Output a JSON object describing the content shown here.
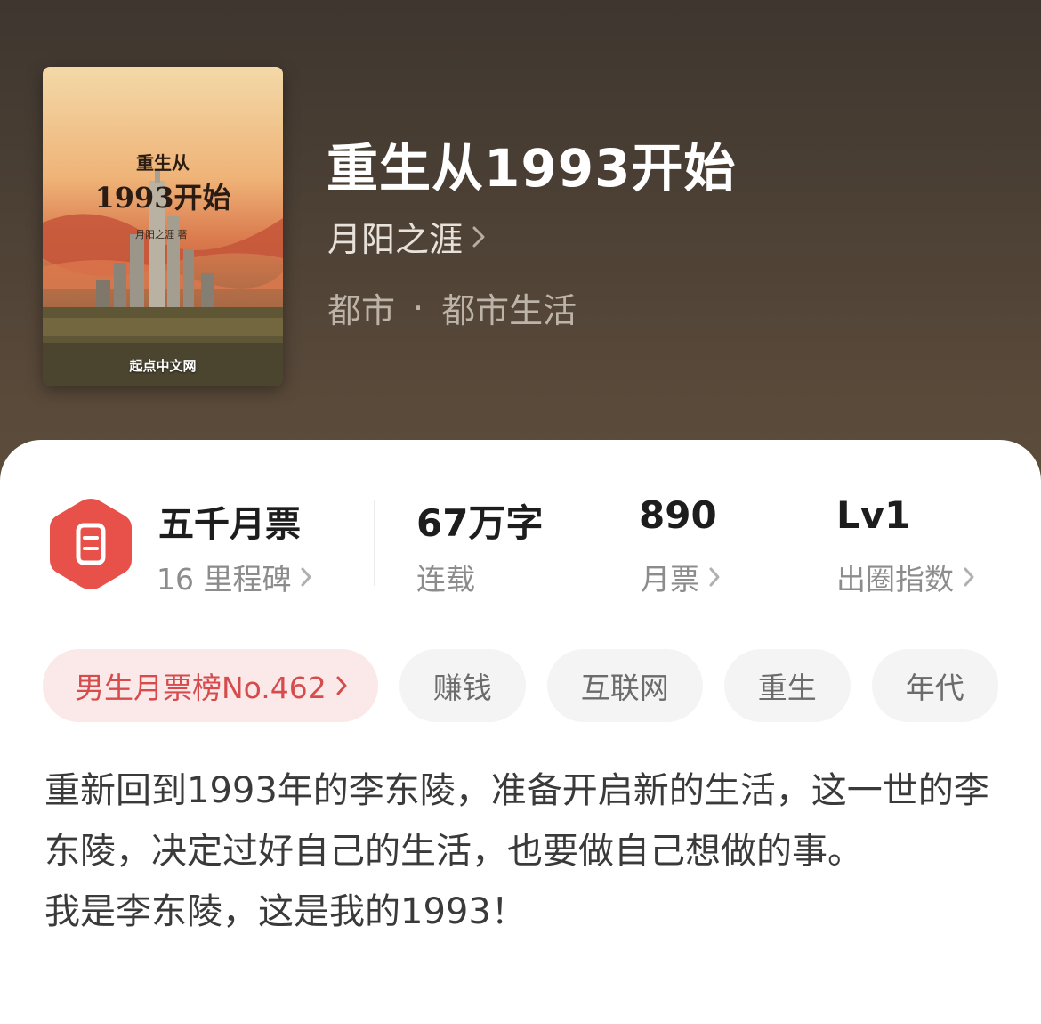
{
  "book": {
    "title": "重生从1993开始",
    "author": "月阳之涯",
    "genre_main": "都市",
    "genre_separator": "·",
    "genre_sub": "都市生活",
    "cover": {
      "title_line1": "重生从",
      "title_line2": "1993开始",
      "author": "月阳之涯 著",
      "publisher": "起点中文网"
    }
  },
  "stats": {
    "milestone_title": "五千月票",
    "milestone_count": "16 里程碑",
    "word_count": "67万字",
    "word_status": "连载",
    "monthly_tickets": "890",
    "monthly_tickets_label": "月票",
    "level": "Lv1",
    "level_label": "出圈指数"
  },
  "tags": {
    "rank": "男生月票榜No.462",
    "items": [
      "赚钱",
      "互联网",
      "重生",
      "年代"
    ]
  },
  "description": {
    "paragraph1": "重新回到1993年的李东陵，准备开启新的生活，这一世的李东陵，决定过好自己的生活，也要做自己想做的事。",
    "paragraph2": "我是李东陵，这是我的1993！"
  },
  "colors": {
    "accent_red": "#e8504a",
    "rank_bg": "#fbe9e9",
    "rank_text": "#d64c4c"
  },
  "icons": [
    "chevron-right-icon",
    "ticket-badge-icon"
  ]
}
